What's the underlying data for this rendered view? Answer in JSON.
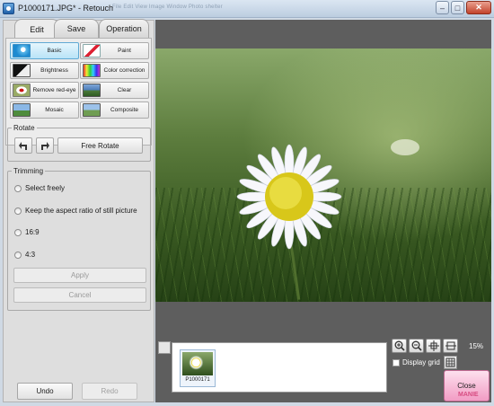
{
  "window": {
    "title": "P1000171.JPG* - Retouch",
    "ghost_menu": "File   Edit   View   Image   Window   Photo shelter"
  },
  "tabs": [
    {
      "label": "Edit",
      "active": true
    },
    {
      "label": "Save",
      "active": false
    },
    {
      "label": "Operation",
      "active": false
    }
  ],
  "tools": [
    {
      "label": "Basic",
      "icon": "basic-icon",
      "selected": true
    },
    {
      "label": "Paint",
      "icon": "paint-brush-icon",
      "selected": false
    },
    {
      "label": "Brightness",
      "icon": "brightness-icon",
      "selected": false
    },
    {
      "label": "Color correction",
      "icon": "color-correction-icon",
      "selected": false
    },
    {
      "label": "Remove red-eye",
      "icon": "red-eye-icon",
      "selected": false
    },
    {
      "label": "Clear",
      "icon": "clear-icon",
      "selected": false
    },
    {
      "label": "Mosaic",
      "icon": "mosaic-icon",
      "selected": false
    },
    {
      "label": "Composite",
      "icon": "composite-icon",
      "selected": false
    }
  ],
  "rotate": {
    "legend": "Rotate",
    "free_rotate_label": "Free Rotate"
  },
  "trimming": {
    "legend": "Trimming",
    "options": [
      "Select freely",
      "Keep the aspect ratio of still picture",
      "16:9",
      "4:3"
    ],
    "apply_label": "Apply",
    "cancel_label": "Cancel"
  },
  "footer": {
    "undo_label": "Undo",
    "redo_label": "Redo"
  },
  "thumbnails": [
    {
      "name": "P1000171"
    }
  ],
  "view_controls": {
    "zoom_level": "15%",
    "display_grid_label": "Display grid",
    "display_grid_checked": false,
    "close_label": "Close"
  },
  "watermark": "MANIE",
  "colors": {
    "accent_selected": "#b9e3f7",
    "close_button": "#f29cc4",
    "preview_bg": "#5e5e5e"
  }
}
